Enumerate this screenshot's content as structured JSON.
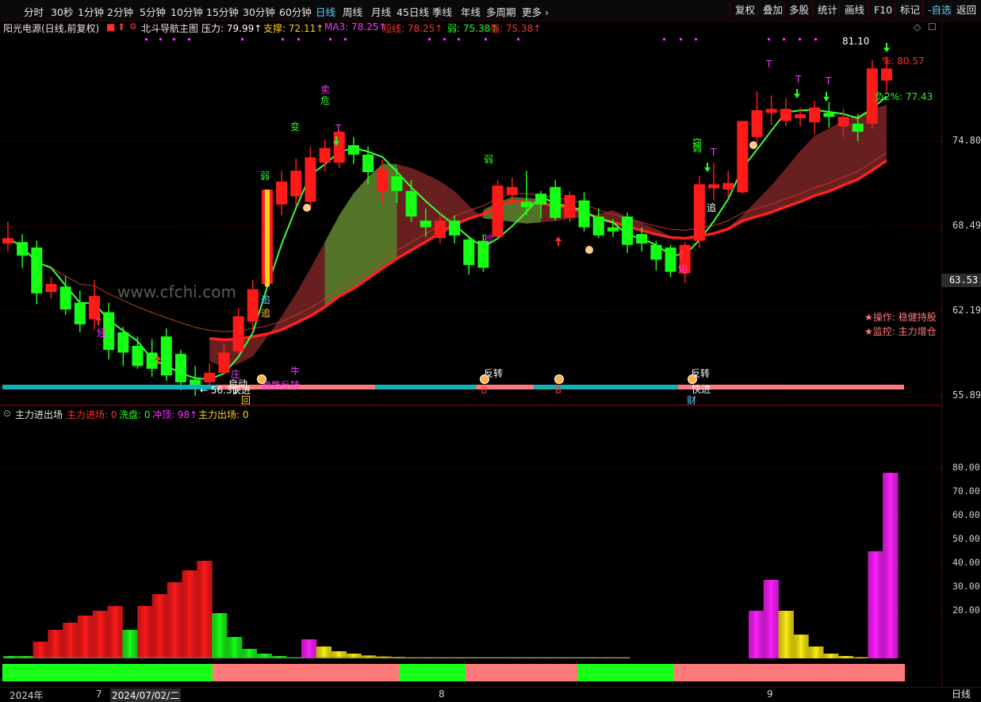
{
  "toolbar": {
    "periods": [
      "分时",
      "30秒",
      "1分钟",
      "2分钟",
      "5分钟",
      "10分钟",
      "15分钟",
      "30分钟",
      "60分钟",
      "日线",
      "周线",
      "月线",
      "45日线",
      "季线",
      "年线",
      "多周期",
      "更多 ›"
    ],
    "active_period": "日线",
    "right_buttons": [
      "复权",
      "叠加",
      "多股",
      "统计",
      "画线",
      "F10",
      "标记",
      "-自选",
      "返回"
    ]
  },
  "info_bar": {
    "stock": "阳光电源(日线,前复权)",
    "indicator": "北斗导航主图",
    "values": [
      {
        "label": "压力: 79.99↑",
        "color": "#ffffff"
      },
      {
        "label": "支撑: 72.11↑",
        "color": "#ffd21a"
      },
      {
        "label": "MA3: 78.25↑",
        "color": "#ff33ff"
      },
      {
        "label": "短线: 78.25↑",
        "color": "#ff3030"
      },
      {
        "label": "弱: 75.38↑",
        "color": "#22ff22"
      },
      {
        "label": "强: 75.38↑",
        "color": "#ff3030"
      }
    ]
  },
  "indicator_bar": {
    "name": "主力进出场",
    "values": [
      {
        "label": "主力进场: 0",
        "color": "#ff3030"
      },
      {
        "label": "洗盘: 0",
        "color": "#22ff22"
      },
      {
        "label": "冲顶: 98↑",
        "color": "#ff33ff"
      },
      {
        "label": "主力出场: 0",
        "color": "#ffd21a"
      }
    ]
  },
  "price_axis": {
    "ticks": [
      "74.80",
      "68.49",
      "62.19",
      "55.89"
    ],
    "current_price": "63.53"
  },
  "indicator_axis": {
    "ticks": [
      "80.00",
      "70.00",
      "60.00",
      "50.00",
      "40.00",
      "30.00",
      "20.00"
    ]
  },
  "x_axis": {
    "labels": [
      "2024年",
      "7",
      "2024/07/02/二",
      "8",
      "9"
    ],
    "period": "日线"
  },
  "annotations": {
    "high_label": "81.10",
    "low_label": "← 56.31",
    "upper_pct": "%: 80.57",
    "lower_pct": "负2%: 77.43",
    "operation": "★操作: 稳健持股",
    "monitor": "★监控: 主力增仓",
    "watermark": "www.cfchi.com",
    "signals": [
      {
        "text": "卖",
        "color": "#ff33ff"
      },
      {
        "text": "危",
        "color": "#22ff22"
      },
      {
        "text": "变",
        "color": "#22ff22"
      },
      {
        "text": "弱",
        "color": "#22ff22"
      },
      {
        "text": "弱",
        "color": "#22ff22"
      },
      {
        "text": "弱",
        "color": "#22ff22"
      },
      {
        "text": "窃",
        "color": "#22ff22"
      },
      {
        "text": "T",
        "color": "#ff33ff"
      },
      {
        "text": "T",
        "color": "#ff33ff"
      },
      {
        "text": "T",
        "color": "#ff33ff"
      },
      {
        "text": "T",
        "color": "#ff33ff"
      },
      {
        "text": "T",
        "color": "#ff33ff"
      },
      {
        "text": "追",
        "color": "#5ad2ff"
      },
      {
        "text": "追",
        "color": "#ffd21a"
      },
      {
        "text": "追",
        "color": "#ffffff"
      },
      {
        "text": "短",
        "color": "#ff33ff"
      },
      {
        "text": "短",
        "color": "#ff33ff"
      },
      {
        "text": "庄",
        "color": "#ff33ff"
      },
      {
        "text": "启动",
        "color": "#ffffff"
      },
      {
        "text": "快进",
        "color": "#ffffff"
      },
      {
        "text": "回",
        "color": "#ffd21a"
      },
      {
        "text": "牛",
        "color": "#ff33ff"
      },
      {
        "text": "趋势反转",
        "color": "#ff33ff"
      },
      {
        "text": "反转",
        "color": "#ffffff"
      },
      {
        "text": "反转",
        "color": "#ffffff"
      },
      {
        "text": "快进",
        "color": "#ffffff"
      },
      {
        "text": "B",
        "color": "#ff3030"
      },
      {
        "text": "B",
        "color": "#ff3030"
      },
      {
        "text": "财",
        "color": "#5ad2ff"
      },
      {
        "text": "抄",
        "color": "#ff33ff"
      }
    ]
  },
  "chart_data": [
    {
      "type": "candlestick",
      "ylim": [
        55.89,
        81.1
      ],
      "price_ticks": [
        74.8,
        68.49,
        62.19,
        55.89
      ],
      "candles": [
        {
          "o": 67.2,
          "c": 67.6,
          "h": 68.8,
          "l": 66.6
        },
        {
          "o": 67.3,
          "c": 66.3,
          "h": 67.9,
          "l": 65.4
        },
        {
          "o": 66.9,
          "c": 63.5,
          "h": 67.4,
          "l": 62.7
        },
        {
          "o": 63.6,
          "c": 64.2,
          "h": 64.7,
          "l": 63.1
        },
        {
          "o": 64.0,
          "c": 62.3,
          "h": 64.8,
          "l": 61.9
        },
        {
          "o": 62.8,
          "c": 61.2,
          "h": 63.7,
          "l": 60.6
        },
        {
          "o": 61.6,
          "c": 63.3,
          "h": 64.5,
          "l": 60.8
        },
        {
          "o": 62.1,
          "c": 59.3,
          "h": 62.8,
          "l": 58.6
        },
        {
          "o": 60.6,
          "c": 59.1,
          "h": 61.0,
          "l": 58.1
        },
        {
          "o": 59.6,
          "c": 58.1,
          "h": 60.3,
          "l": 57.9
        },
        {
          "o": 59.1,
          "c": 57.9,
          "h": 60.1,
          "l": 57.3
        },
        {
          "o": 60.3,
          "c": 57.4,
          "h": 60.9,
          "l": 57.0
        },
        {
          "o": 59.0,
          "c": 56.9,
          "h": 59.3,
          "l": 56.3
        },
        {
          "o": 57.1,
          "c": 56.6,
          "h": 58.1,
          "l": 55.9
        },
        {
          "o": 56.9,
          "c": 57.6,
          "h": 58.3,
          "l": 56.5
        },
        {
          "o": 57.6,
          "c": 59.1,
          "h": 59.8,
          "l": 57.5
        },
        {
          "o": 59.2,
          "c": 61.8,
          "h": 62.4,
          "l": 59.1
        },
        {
          "o": 61.4,
          "c": 63.8,
          "h": 64.5,
          "l": 60.7
        },
        {
          "o": 64.2,
          "c": 71.2,
          "h": 71.2,
          "l": 64.0
        },
        {
          "o": 70.1,
          "c": 71.8,
          "h": 72.6,
          "l": 69.3
        },
        {
          "o": 70.7,
          "c": 72.6,
          "h": 73.5,
          "l": 70.0
        },
        {
          "o": 70.3,
          "c": 73.6,
          "h": 74.4,
          "l": 69.7
        },
        {
          "o": 73.2,
          "c": 74.3,
          "h": 74.9,
          "l": 72.6
        },
        {
          "o": 73.2,
          "c": 75.5,
          "h": 75.6,
          "l": 72.8
        },
        {
          "o": 74.5,
          "c": 73.8,
          "h": 75.1,
          "l": 73.1
        },
        {
          "o": 73.8,
          "c": 72.5,
          "h": 74.4,
          "l": 71.6
        },
        {
          "o": 71.1,
          "c": 72.7,
          "h": 73.4,
          "l": 70.2
        },
        {
          "o": 72.2,
          "c": 71.1,
          "h": 72.8,
          "l": 70.2
        },
        {
          "o": 71.1,
          "c": 69.2,
          "h": 71.9,
          "l": 68.8
        },
        {
          "o": 68.9,
          "c": 68.4,
          "h": 69.8,
          "l": 67.7
        },
        {
          "o": 67.6,
          "c": 68.9,
          "h": 69.4,
          "l": 67.2
        },
        {
          "o": 68.9,
          "c": 67.8,
          "h": 69.3,
          "l": 67.2
        },
        {
          "o": 67.5,
          "c": 65.6,
          "h": 67.6,
          "l": 64.9
        },
        {
          "o": 67.4,
          "c": 65.4,
          "h": 67.9,
          "l": 65.1
        },
        {
          "o": 67.7,
          "c": 71.5,
          "h": 71.9,
          "l": 67.6
        },
        {
          "o": 70.8,
          "c": 71.4,
          "h": 72.1,
          "l": 70.2
        },
        {
          "o": 70.3,
          "c": 69.9,
          "h": 72.6,
          "l": 69.3
        },
        {
          "o": 70.9,
          "c": 70.1,
          "h": 71.1,
          "l": 69.1
        },
        {
          "o": 71.4,
          "c": 69.1,
          "h": 71.9,
          "l": 68.9
        },
        {
          "o": 69.1,
          "c": 70.8,
          "h": 71.1,
          "l": 68.8
        },
        {
          "o": 70.4,
          "c": 68.4,
          "h": 71.0,
          "l": 68.1
        },
        {
          "o": 69.2,
          "c": 67.8,
          "h": 69.8,
          "l": 67.6
        },
        {
          "o": 68.4,
          "c": 68.1,
          "h": 69.0,
          "l": 67.7
        },
        {
          "o": 69.2,
          "c": 67.1,
          "h": 69.5,
          "l": 66.5
        },
        {
          "o": 67.9,
          "c": 67.2,
          "h": 68.4,
          "l": 66.6
        },
        {
          "o": 67.1,
          "c": 66.0,
          "h": 67.4,
          "l": 65.2
        },
        {
          "o": 66.9,
          "c": 65.1,
          "h": 67.1,
          "l": 64.7
        },
        {
          "o": 65.0,
          "c": 67.1,
          "h": 67.3,
          "l": 64.3
        },
        {
          "o": 67.4,
          "c": 71.6,
          "h": 72.2,
          "l": 66.9
        },
        {
          "o": 71.3,
          "c": 71.6,
          "h": 73.2,
          "l": 70.4
        },
        {
          "o": 71.2,
          "c": 71.7,
          "h": 72.6,
          "l": 70.6
        },
        {
          "o": 71.0,
          "c": 76.3,
          "h": 76.3,
          "l": 70.9
        },
        {
          "o": 75.1,
          "c": 77.1,
          "h": 78.5,
          "l": 74.7
        },
        {
          "o": 76.9,
          "c": 77.2,
          "h": 78.2,
          "l": 76.0
        },
        {
          "o": 76.3,
          "c": 77.2,
          "h": 78.0,
          "l": 75.9
        },
        {
          "o": 76.5,
          "c": 76.8,
          "h": 77.3,
          "l": 75.9
        },
        {
          "o": 76.2,
          "c": 77.3,
          "h": 77.8,
          "l": 75.3
        },
        {
          "o": 76.9,
          "c": 76.6,
          "h": 77.7,
          "l": 75.8
        },
        {
          "o": 75.9,
          "c": 76.6,
          "h": 77.2,
          "l": 75.1
        },
        {
          "o": 76.1,
          "c": 75.5,
          "h": 76.8,
          "l": 74.8
        },
        {
          "o": 76.1,
          "c": 80.2,
          "h": 80.8,
          "l": 75.7
        },
        {
          "o": 79.3,
          "c": 80.2,
          "h": 81.1,
          "l": 78.4
        }
      ]
    },
    {
      "type": "bar",
      "name": "主力进出场",
      "ylim": [
        0,
        80
      ],
      "bars": [
        {
          "v": 1,
          "c": "g"
        },
        {
          "v": 1,
          "c": "g"
        },
        {
          "v": 7,
          "c": "r"
        },
        {
          "v": 12,
          "c": "r"
        },
        {
          "v": 15,
          "c": "r"
        },
        {
          "v": 18,
          "c": "r"
        },
        {
          "v": 20,
          "c": "r"
        },
        {
          "v": 22,
          "c": "r"
        },
        {
          "v": 12,
          "c": "g"
        },
        {
          "v": 22,
          "c": "r"
        },
        {
          "v": 27,
          "c": "r"
        },
        {
          "v": 32,
          "c": "r"
        },
        {
          "v": 37,
          "c": "r"
        },
        {
          "v": 41,
          "c": "r"
        },
        {
          "v": 19,
          "c": "g"
        },
        {
          "v": 9,
          "c": "g"
        },
        {
          "v": 4,
          "c": "g"
        },
        {
          "v": 2,
          "c": "g"
        },
        {
          "v": 1,
          "c": "g"
        },
        {
          "v": 0.5,
          "c": "g"
        },
        {
          "v": 8,
          "c": "m"
        },
        {
          "v": 5,
          "c": "y"
        },
        {
          "v": 3,
          "c": "y"
        },
        {
          "v": 2,
          "c": "y"
        },
        {
          "v": 1.2,
          "c": "y"
        },
        {
          "v": 0.8,
          "c": "y"
        },
        {
          "v": 0.6,
          "c": "y"
        },
        {
          "v": 0.5,
          "c": "y"
        },
        {
          "v": 0.5,
          "c": "y"
        },
        {
          "v": 0.4,
          "c": "y"
        },
        {
          "v": 0.4,
          "c": "y"
        },
        {
          "v": 0.4,
          "c": "y"
        },
        {
          "v": 0.4,
          "c": "y"
        },
        {
          "v": 0.4,
          "c": "y"
        },
        {
          "v": 0.4,
          "c": "y"
        },
        {
          "v": 0.4,
          "c": "y"
        },
        {
          "v": 0.4,
          "c": "y"
        },
        {
          "v": 0.4,
          "c": "y"
        },
        {
          "v": 0.4,
          "c": "y"
        },
        {
          "v": 0.4,
          "c": "y"
        },
        {
          "v": 0.4,
          "c": "y"
        },
        {
          "v": 0.4,
          "c": "y"
        },
        {
          "v": 0,
          "c": "y"
        },
        {
          "v": 0,
          "c": "y"
        },
        {
          "v": 0,
          "c": "y"
        },
        {
          "v": 0,
          "c": "y"
        },
        {
          "v": 0,
          "c": "y"
        },
        {
          "v": 0,
          "c": "y"
        },
        {
          "v": 0,
          "c": "y"
        },
        {
          "v": 0,
          "c": "y"
        },
        {
          "v": 20,
          "c": "m"
        },
        {
          "v": 33,
          "c": "m"
        },
        {
          "v": 20,
          "c": "y"
        },
        {
          "v": 10,
          "c": "y"
        },
        {
          "v": 5,
          "c": "y"
        },
        {
          "v": 2,
          "c": "y"
        },
        {
          "v": 1,
          "c": "y"
        },
        {
          "v": 0.5,
          "c": "y"
        },
        {
          "v": 45,
          "c": "m"
        },
        {
          "v": 78,
          "c": "m"
        }
      ]
    }
  ]
}
